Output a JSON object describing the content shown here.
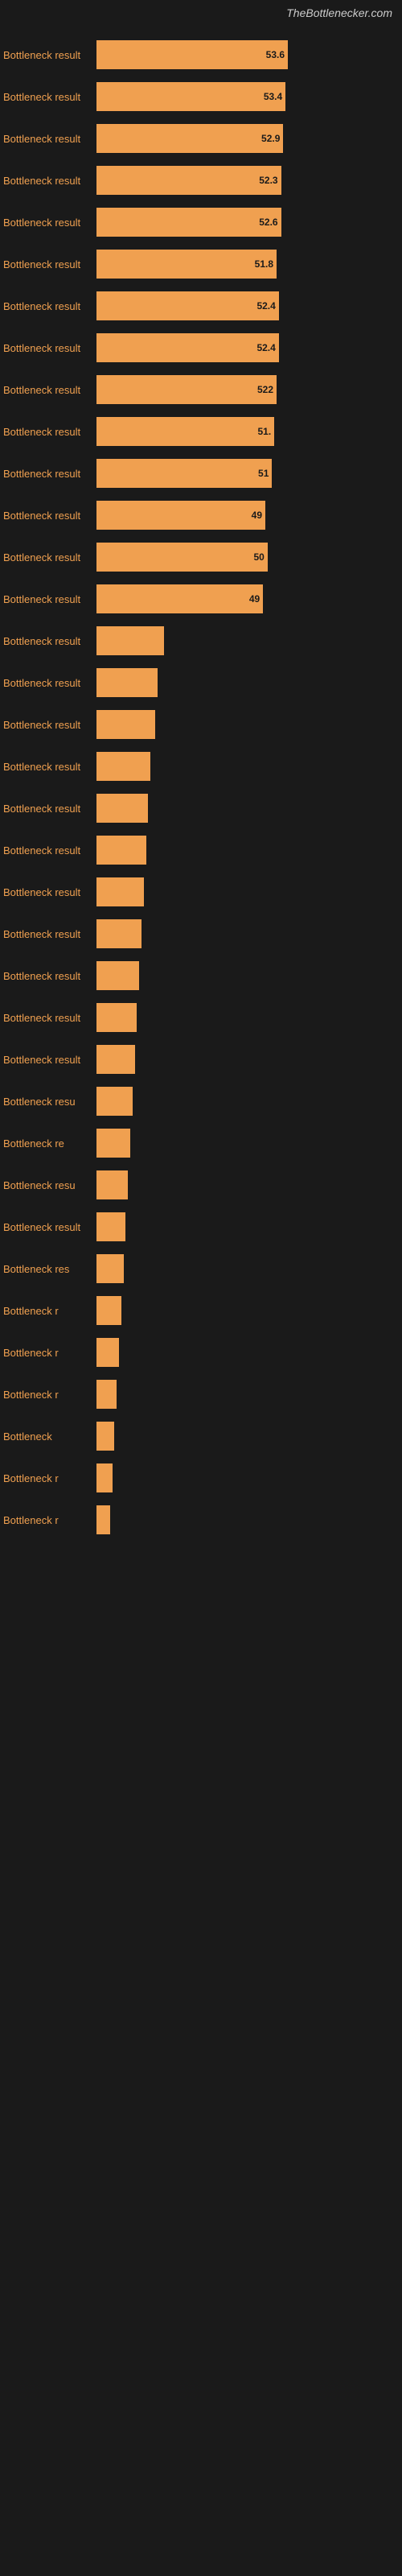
{
  "header": {
    "title": "TheBottlenecker.com"
  },
  "bars": [
    {
      "label": "Bottleneck result",
      "value": 53.6,
      "display": "53.6",
      "width_pct": 85
    },
    {
      "label": "Bottleneck result",
      "value": 53.4,
      "display": "53.4",
      "width_pct": 84
    },
    {
      "label": "Bottleneck result",
      "value": 52.9,
      "display": "52.9",
      "width_pct": 83
    },
    {
      "label": "Bottleneck result",
      "value": 52.3,
      "display": "52.3",
      "width_pct": 82
    },
    {
      "label": "Bottleneck result",
      "value": 52.6,
      "display": "52.6",
      "width_pct": 82
    },
    {
      "label": "Bottleneck result",
      "value": 51.8,
      "display": "51.8",
      "width_pct": 80
    },
    {
      "label": "Bottleneck result",
      "value": 52.4,
      "display": "52.4",
      "width_pct": 81
    },
    {
      "label": "Bottleneck result",
      "value": 52.4,
      "display": "52.4",
      "width_pct": 81
    },
    {
      "label": "Bottleneck result",
      "value": 52.2,
      "display": "522",
      "width_pct": 80
    },
    {
      "label": "Bottleneck result",
      "value": 51.5,
      "display": "51.",
      "width_pct": 79
    },
    {
      "label": "Bottleneck result",
      "value": 51.0,
      "display": "51",
      "width_pct": 78
    },
    {
      "label": "Bottleneck result",
      "value": 49.5,
      "display": "49",
      "width_pct": 75
    },
    {
      "label": "Bottleneck result",
      "value": 50.2,
      "display": "50",
      "width_pct": 76
    },
    {
      "label": "Bottleneck result",
      "value": 49.1,
      "display": "49",
      "width_pct": 74
    },
    {
      "label": "Bottleneck result",
      "value": null,
      "display": "",
      "width_pct": 30
    },
    {
      "label": "Bottleneck result",
      "value": null,
      "display": "",
      "width_pct": 27
    },
    {
      "label": "Bottleneck result",
      "value": null,
      "display": "",
      "width_pct": 26
    },
    {
      "label": "Bottleneck result",
      "value": null,
      "display": "",
      "width_pct": 24
    },
    {
      "label": "Bottleneck result",
      "value": null,
      "display": "",
      "width_pct": 23
    },
    {
      "label": "Bottleneck result",
      "value": null,
      "display": "",
      "width_pct": 22
    },
    {
      "label": "Bottleneck result",
      "value": null,
      "display": "",
      "width_pct": 21
    },
    {
      "label": "Bottleneck result",
      "value": null,
      "display": "",
      "width_pct": 20
    },
    {
      "label": "Bottleneck result",
      "value": null,
      "display": "",
      "width_pct": 19
    },
    {
      "label": "Bottleneck result",
      "value": null,
      "display": "",
      "width_pct": 18
    },
    {
      "label": "Bottleneck result",
      "value": null,
      "display": "",
      "width_pct": 17
    },
    {
      "label": "Bottleneck resu",
      "value": null,
      "display": "",
      "width_pct": 16
    },
    {
      "label": "Bottleneck re",
      "value": null,
      "display": "",
      "width_pct": 15
    },
    {
      "label": "Bottleneck resu",
      "value": null,
      "display": "",
      "width_pct": 14
    },
    {
      "label": "Bottleneck result",
      "value": null,
      "display": "",
      "width_pct": 13
    },
    {
      "label": "Bottleneck res",
      "value": null,
      "display": "",
      "width_pct": 12
    },
    {
      "label": "Bottleneck r",
      "value": null,
      "display": "",
      "width_pct": 11
    },
    {
      "label": "Bottleneck r",
      "value": null,
      "display": "",
      "width_pct": 10
    },
    {
      "label": "Bottleneck r",
      "value": null,
      "display": "",
      "width_pct": 9
    },
    {
      "label": "Bottleneck",
      "value": null,
      "display": "",
      "width_pct": 8
    },
    {
      "label": "Bottleneck r",
      "value": null,
      "display": "",
      "width_pct": 7
    },
    {
      "label": "Bottleneck r",
      "value": null,
      "display": "",
      "width_pct": 6
    }
  ]
}
